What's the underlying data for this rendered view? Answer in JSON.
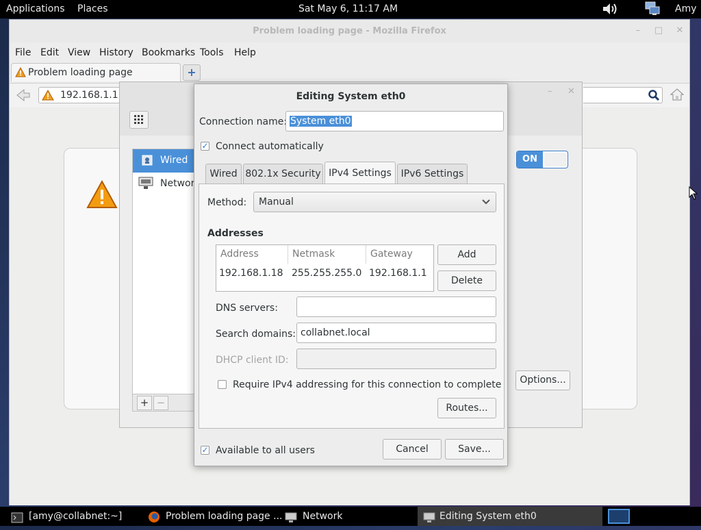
{
  "top_panel": {
    "applications": "Applications",
    "places": "Places",
    "clock": "Sat May  6, 11:17 AM",
    "user": "Amy"
  },
  "firefox": {
    "window_title": "Problem loading page - Mozilla Firefox",
    "menu": [
      "File",
      "Edit",
      "View",
      "History",
      "Bookmarks",
      "Tools",
      "Help"
    ],
    "tab_title": "Problem loading page",
    "url": "192.168.1.1"
  },
  "network_window": {
    "items": [
      "Wired",
      "Network"
    ],
    "switch_label": "ON",
    "options_label": "Options..."
  },
  "dialog": {
    "title": "Editing System eth0",
    "connection_name_label": "Connection name:",
    "connection_name_value": "System eth0",
    "connect_automatically": "Connect automatically",
    "tabs": [
      "Wired",
      "802.1x Security",
      "IPv4 Settings",
      "IPv6 Settings"
    ],
    "method_label": "Method:",
    "method_value": "Manual",
    "addresses_heading": "Addresses",
    "columns": [
      "Address",
      "Netmask",
      "Gateway"
    ],
    "rows": [
      [
        "192.168.1.18",
        "255.255.255.0",
        "192.168.1.1"
      ]
    ],
    "add_label": "Add",
    "delete_label": "Delete",
    "dns_label": "DNS servers:",
    "dns_value": "",
    "search_domains_label": "Search domains:",
    "search_domains_value": "collabnet.local",
    "dhcp_label": "DHCP client ID:",
    "dhcp_value": "",
    "require_ipv4": "Require IPv4 addressing for this connection to complete",
    "routes_label": "Routes...",
    "available_all_users": "Available to all users",
    "cancel_label": "Cancel",
    "save_label": "Save..."
  },
  "taskbar": {
    "tasks": [
      "[amy@collabnet:~]",
      "Problem loading page ...",
      "Network",
      "Editing System eth0"
    ]
  },
  "icons": {
    "warning": "warning-icon",
    "volume": "volume-icon",
    "network_status": "network-icon"
  }
}
